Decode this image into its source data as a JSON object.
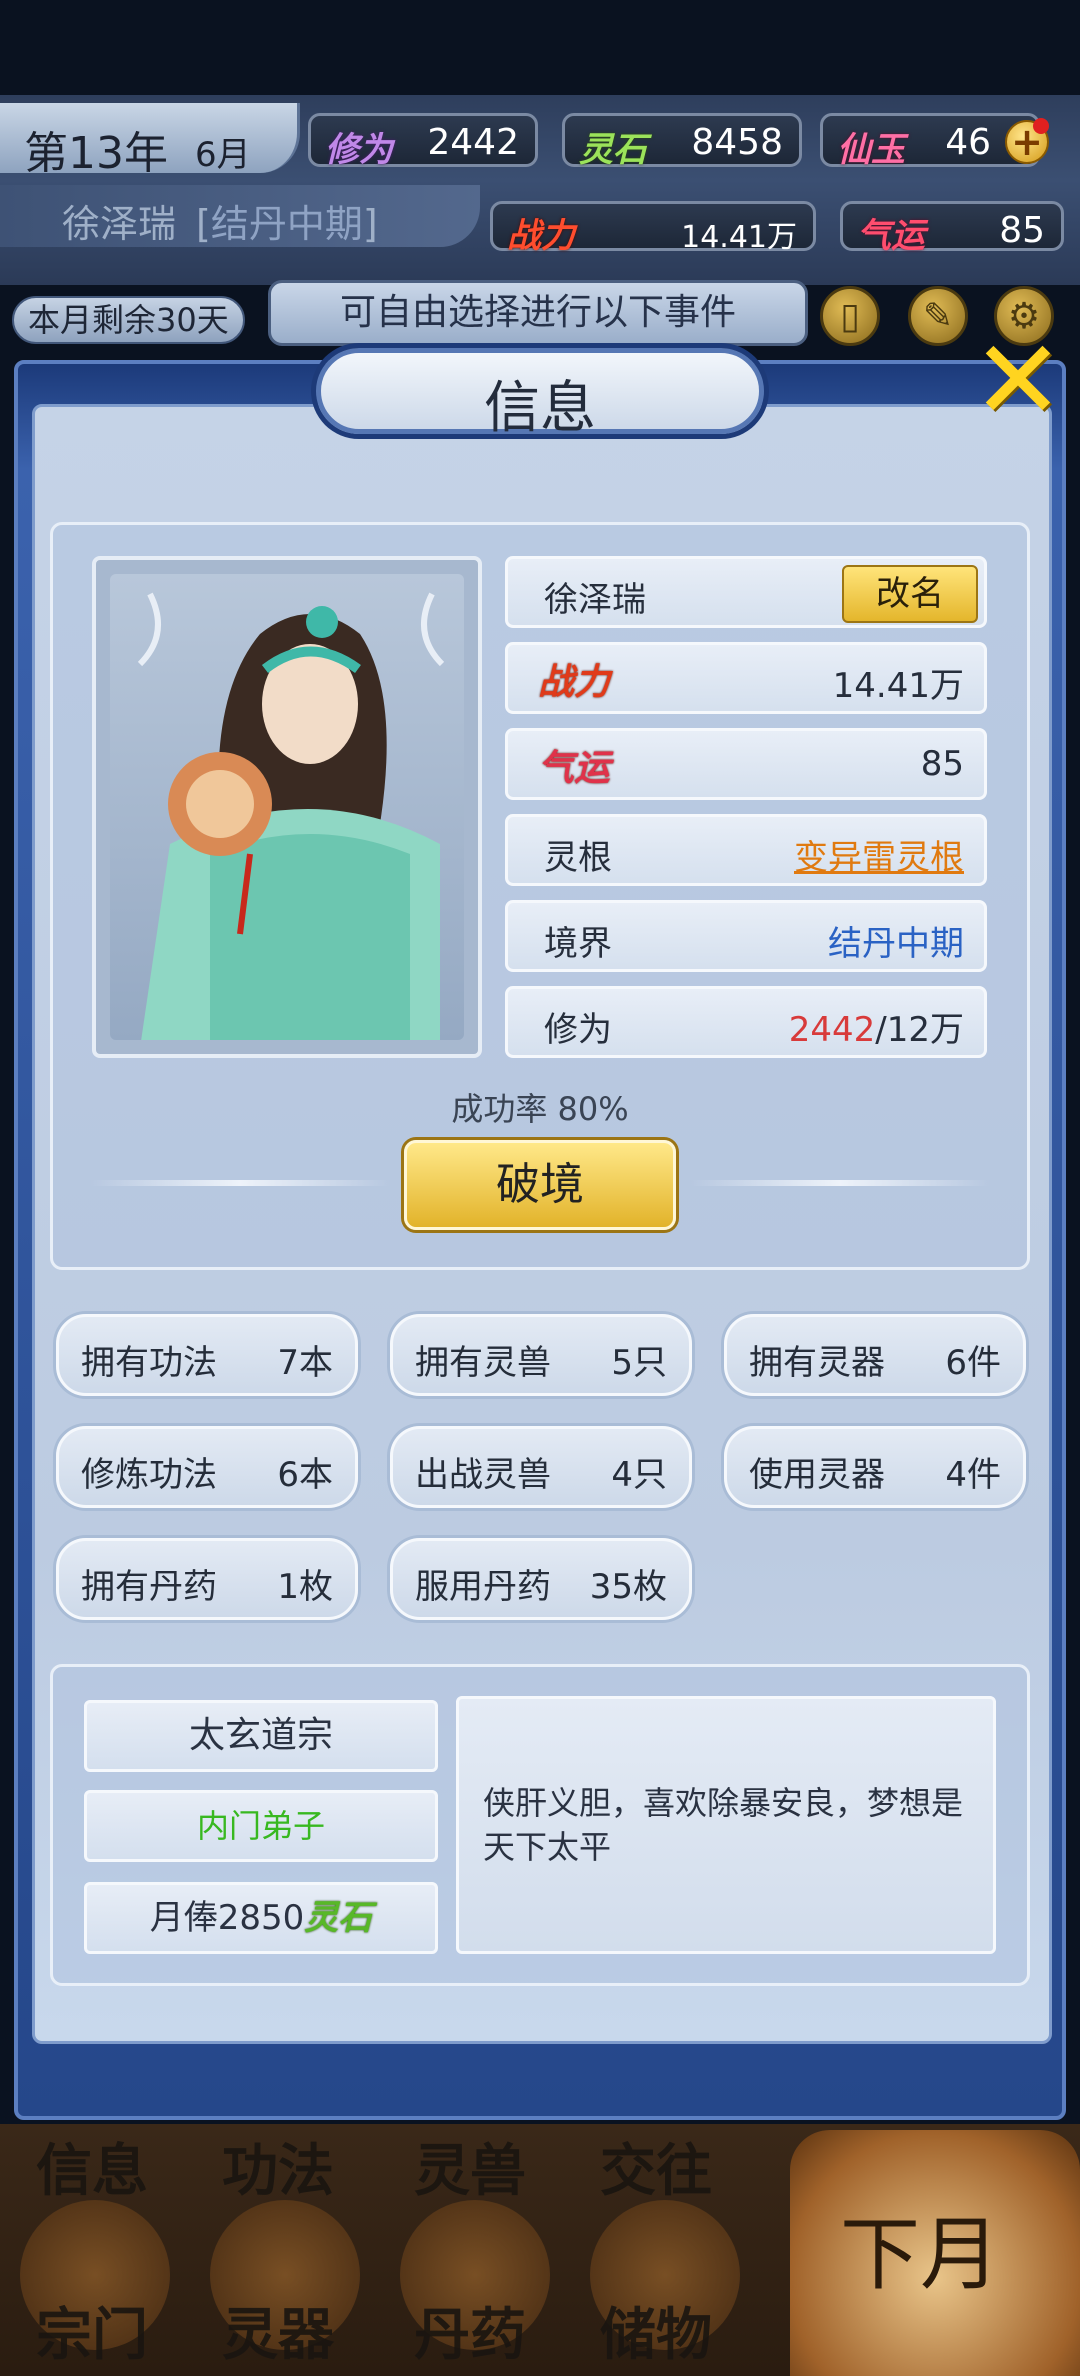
{
  "hud": {
    "year": "第13年",
    "month": "6月",
    "cultivation_label": "修为",
    "cultivation_value": "2442",
    "spirit_stone_label": "灵石",
    "spirit_stone_value": "8458",
    "jade_label": "仙玉",
    "jade_value": "46",
    "char_name": "徐泽瑞",
    "realm_open": "[",
    "realm": "结丹中期",
    "realm_close": "]",
    "power_label": "战力",
    "power_value": "14.41万",
    "luck_label": "气运",
    "luck_value": "85",
    "remaining": "本月剩余30天",
    "event_prompt": "可自由选择进行以下事件"
  },
  "modal": {
    "title": "信息",
    "name": "徐泽瑞",
    "rename_label": "改名",
    "power_label": "战力",
    "power_value": "14.41万",
    "luck_label": "气运",
    "luck_value": "85",
    "root_label": "灵根",
    "root_value": "变异雷灵根",
    "realm_label": "境界",
    "realm_value": "结丹中期",
    "cult_label": "修为",
    "cult_current": "2442",
    "cult_max": "/12万",
    "success_rate": "成功率 80%",
    "breakthrough_label": "破境"
  },
  "stats": [
    {
      "k": "拥有功法",
      "v": "7本"
    },
    {
      "k": "拥有灵兽",
      "v": "5只"
    },
    {
      "k": "拥有灵器",
      "v": "6件"
    },
    {
      "k": "修炼功法",
      "v": "6本"
    },
    {
      "k": "出战灵兽",
      "v": "4只"
    },
    {
      "k": "使用灵器",
      "v": "4件"
    },
    {
      "k": "拥有丹药",
      "v": "1枚"
    },
    {
      "k": "服用丹药",
      "v": "35枚"
    }
  ],
  "clan": {
    "name": "太玄道宗",
    "rank": "内门弟子",
    "salary_prefix": "月俸2850",
    "salary_unit": "灵石",
    "description": "侠肝义胆，喜欢除暴安良，梦想是天下太平"
  },
  "bottom_nav": {
    "labels_top": [
      "信息",
      "功法",
      "灵兽",
      "交往"
    ],
    "labels_bottom": [
      "宗门",
      "灵器",
      "丹药",
      "储物"
    ],
    "next_month": "下月"
  },
  "colors": {
    "accent_gold": "#e4b62c",
    "frame_blue": "#3b62ad",
    "red_value": "#d83a3a",
    "orange_link": "#e07a10",
    "green_rank": "#38b820"
  }
}
